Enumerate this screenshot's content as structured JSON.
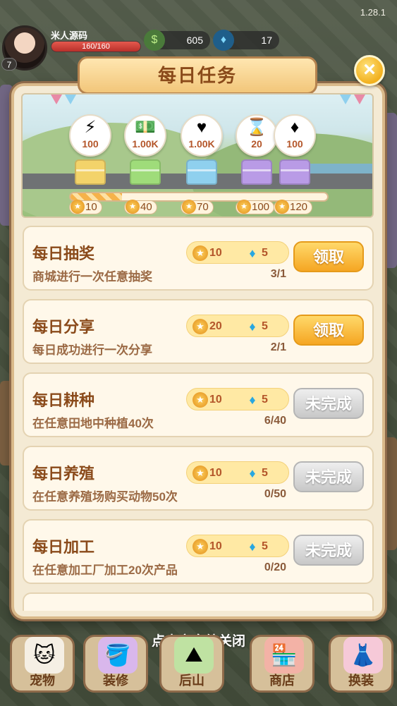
{
  "version": "1.28.1",
  "player": {
    "name": "米人源码",
    "level": "7",
    "hp": "160/160",
    "hp_fraction": 1.0
  },
  "resources": {
    "cash": "605",
    "gems": "17"
  },
  "panel": {
    "title": "每日任务",
    "close_icon": "×"
  },
  "reward_track": {
    "chests": [
      {
        "reward": "100",
        "icon": "lightning-icon",
        "symbol": "⚡",
        "color": "#f3d36a"
      },
      {
        "reward": "1.00K",
        "icon": "cash-icon",
        "symbol": "💵",
        "color": "#9fdc7a"
      },
      {
        "reward": "1.00K",
        "icon": "heart-icon",
        "symbol": "♥",
        "color": "#8fd0ee"
      },
      {
        "reward": "20",
        "icon": "hourglass-icon",
        "symbol": "⌛",
        "color": "#b99be6"
      },
      {
        "reward": "100",
        "icon": "gem-icon",
        "symbol": "♦",
        "color": "#b99be6"
      }
    ],
    "milestones": [
      "10",
      "40",
      "70",
      "100",
      "120"
    ],
    "progress_fraction": 0.2
  },
  "tasks": [
    {
      "name": "每日抽奖",
      "desc": "商城进行一次任意抽奖",
      "medal": "10",
      "gem": "5",
      "progress": "3/1",
      "button": "领取",
      "state": "claim"
    },
    {
      "name": "每日分享",
      "desc": "每日成功进行一次分享",
      "medal": "20",
      "gem": "5",
      "progress": "2/1",
      "button": "领取",
      "state": "claim"
    },
    {
      "name": "每日耕种",
      "desc": "在任意田地中种植40次",
      "medal": "10",
      "gem": "5",
      "progress": "6/40",
      "button": "未完成",
      "state": "pending"
    },
    {
      "name": "每日养殖",
      "desc": "在任意养殖场购买动物50次",
      "medal": "10",
      "gem": "5",
      "progress": "0/50",
      "button": "未完成",
      "state": "pending"
    },
    {
      "name": "每日加工",
      "desc": "在任意加工厂加工20次产品",
      "medal": "10",
      "gem": "5",
      "progress": "0/20",
      "button": "未完成",
      "state": "pending"
    }
  ],
  "close_hint": "点击空白处关闭",
  "nav": [
    {
      "label": "宠物",
      "icon": "cat-icon",
      "symbol": "🐱",
      "bg": "#f5efe4"
    },
    {
      "label": "装修",
      "icon": "paint-bucket-icon",
      "symbol": "🪣",
      "bg": "#d9b7ec"
    },
    {
      "label": "后山",
      "icon": "mountain-icon",
      "symbol": "⛰",
      "bg": "#bfe2a2"
    },
    {
      "label": "商店",
      "icon": "shop-icon",
      "symbol": "🏪",
      "bg": "#f3b2a6"
    },
    {
      "label": "换装",
      "icon": "dress-icon",
      "symbol": "👗",
      "bg": "#f6c9d8"
    }
  ],
  "colors": {
    "claim_button": "#f5a623",
    "pending_button": "#c8c8c8",
    "title_text": "#8a4a1a",
    "gem": "#28a7e0"
  }
}
